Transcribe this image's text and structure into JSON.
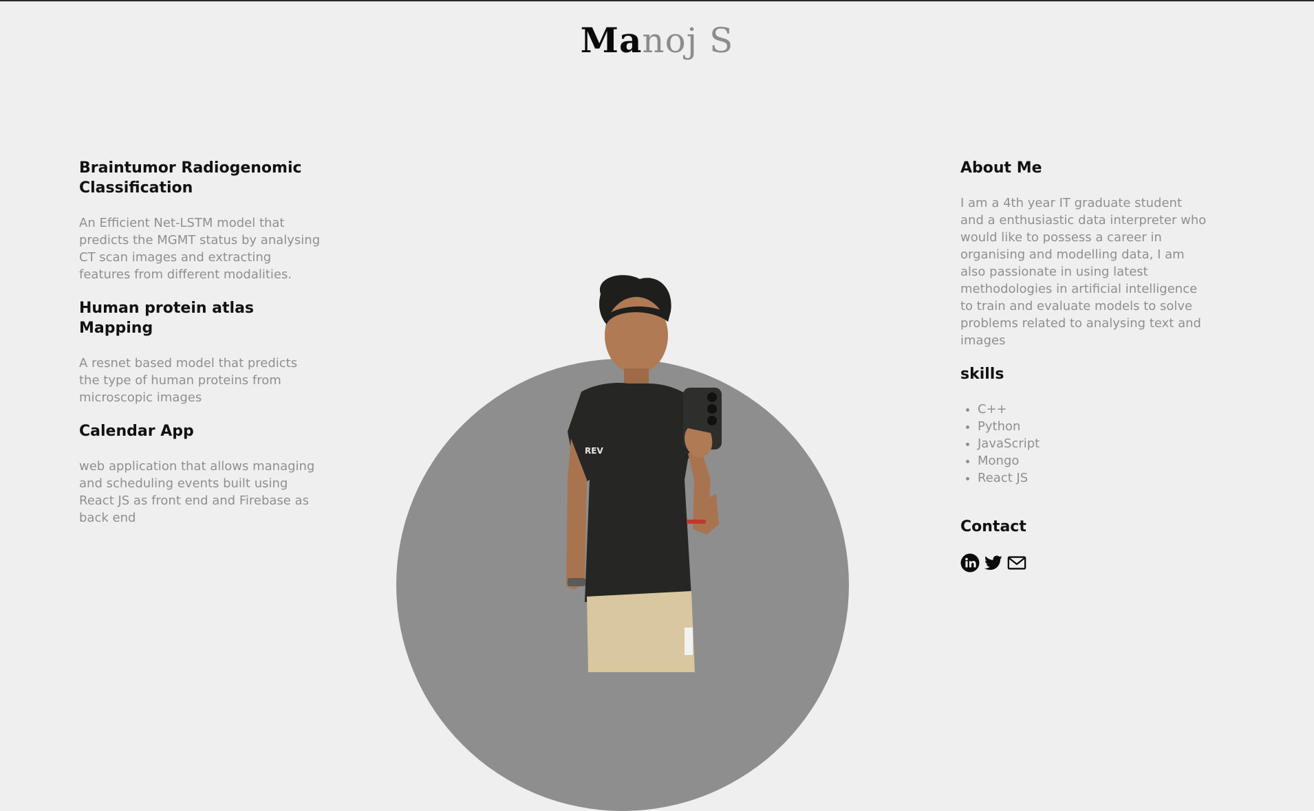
{
  "header": {
    "logo_part1": "Ma",
    "logo_part2": "noj S"
  },
  "projects": [
    {
      "title": "Braintumor Radiogenomic Classification",
      "description": "An Efficient Net-LSTM model that predicts the MGMT status by analysing CT scan images and extracting features from different modalities."
    },
    {
      "title": "Human protein atlas Mapping",
      "description": "A resnet based model that predicts the type of human proteins from microscopic images"
    },
    {
      "title": "Calendar App",
      "description": "web application that allows managing and scheduling events built using React JS as front end and Firebase as back end"
    }
  ],
  "about": {
    "title": "About Me",
    "description": "I am a 4th year IT graduate student and a enthusiastic data interpreter who would like to possess a career in organising and modelling data, I am also passionate in using latest methodologies in artificial intelligence to train and evaluate models to solve problems related to analysing text and images"
  },
  "skills": {
    "title": "skills",
    "items": [
      "C++",
      "Python",
      "JavaScript",
      "Mongo",
      "React JS"
    ]
  },
  "contact": {
    "title": "Contact",
    "icons": [
      "linkedin-icon",
      "twitter-icon",
      "mail-icon"
    ]
  },
  "colors": {
    "background": "#efefef",
    "circle": "#8e8e8e",
    "heading": "#111111",
    "body_text": "#8f8f8f"
  }
}
